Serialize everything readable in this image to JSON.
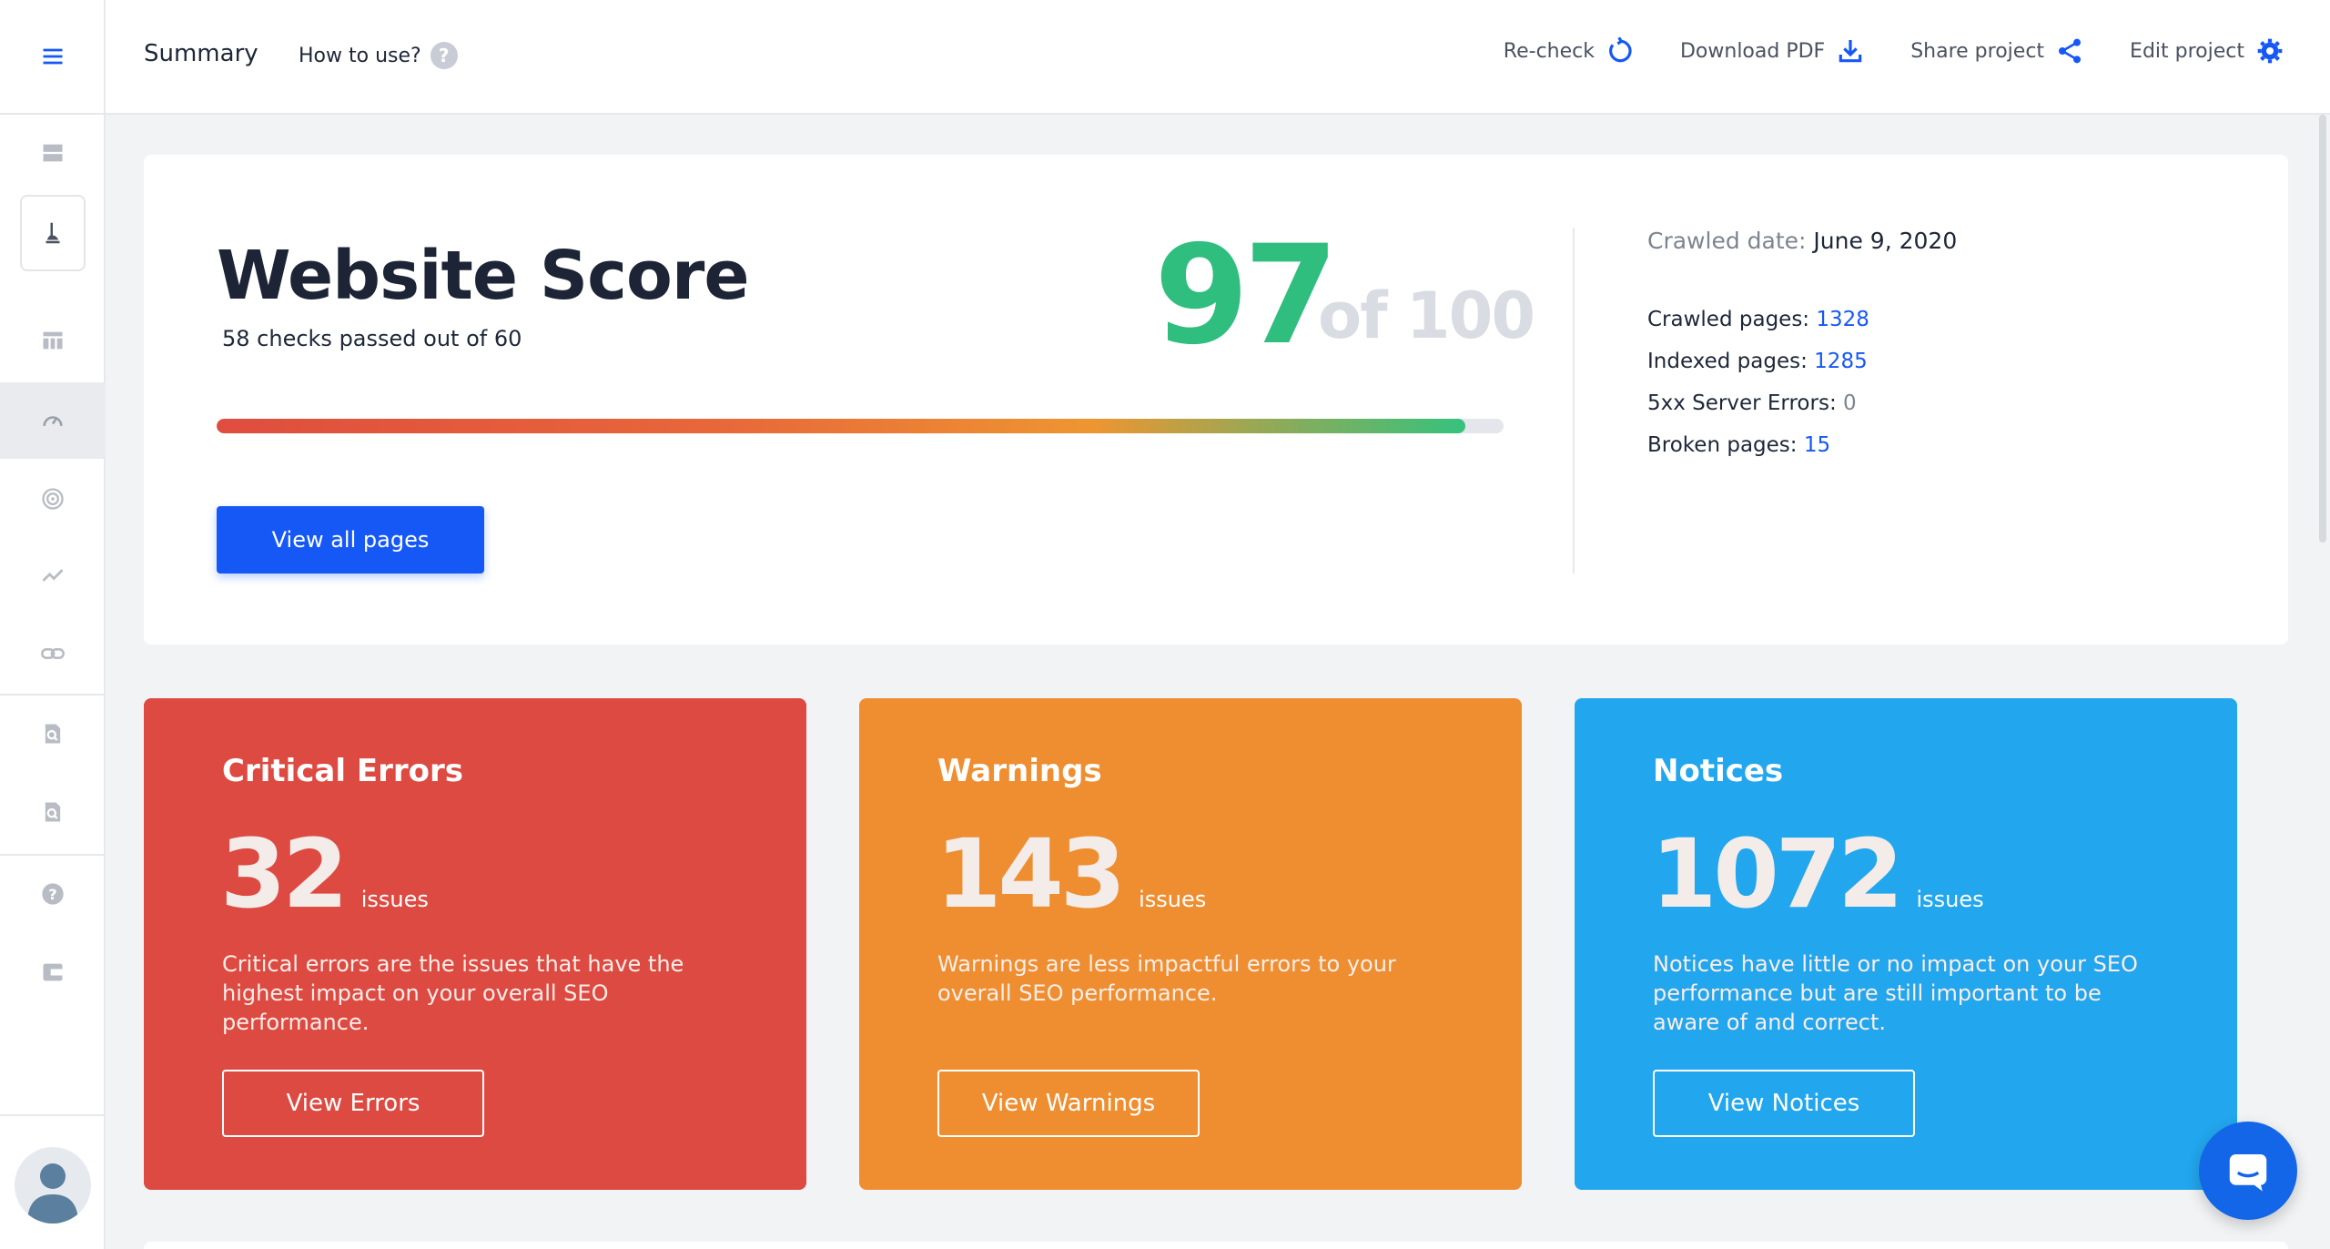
{
  "header": {
    "title": "Summary",
    "how_to_use": "How to use?",
    "help_glyph": "?",
    "actions": [
      {
        "label": "Re-check",
        "icon": "refresh-icon"
      },
      {
        "label": "Download PDF",
        "icon": "download-icon"
      },
      {
        "label": "Share project",
        "icon": "share-icon"
      },
      {
        "label": "Edit project",
        "icon": "gear-icon"
      }
    ]
  },
  "score": {
    "title": "Website Score",
    "checks_text": "58 checks passed out of 60",
    "value": "97",
    "of_text": "of 100",
    "progress_fraction": 0.97,
    "button": "View all pages",
    "crawled_date_label": "Crawled date:",
    "crawled_date_value": "June 9, 2020",
    "stats": [
      {
        "label": "Crawled pages:",
        "value": "1328"
      },
      {
        "label": "Indexed pages:",
        "value": "1285"
      },
      {
        "label": "5xx Server Errors:",
        "value": "0"
      },
      {
        "label": "Broken pages:",
        "value": "15"
      }
    ]
  },
  "issues": [
    {
      "title": "Critical Errors",
      "count": "32",
      "unit": "issues",
      "description": "Critical errors are the issues that have the highest impact on your overall SEO performance.",
      "button": "View Errors",
      "color": "#dd4a41"
    },
    {
      "title": "Warnings",
      "count": "143",
      "unit": "issues",
      "description": "Warnings are less impactful errors to your overall SEO performance.",
      "button": "View Warnings",
      "color": "#ef8e30"
    },
    {
      "title": "Notices",
      "count": "1072",
      "unit": "issues",
      "description": "Notices have little or no impact on your SEO performance but are still important to be aware of and correct.",
      "button": "View Notices",
      "color": "#22a6ed"
    }
  ],
  "colors": {
    "accent": "#1558f5",
    "score_green": "#2fbe7e"
  },
  "sidebar": {
    "icons": [
      "menu-icon",
      "server-icon",
      "brand-logo-icon",
      "table-icon",
      "dashboard-gauge-icon",
      "target-icon",
      "trend-icon",
      "link-icon",
      "search-doc-icon",
      "search-doc-icon",
      "help-icon",
      "card-icon",
      "user-avatar"
    ]
  }
}
